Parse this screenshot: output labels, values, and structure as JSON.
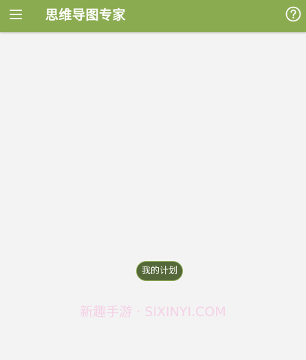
{
  "toolbar": {
    "title": "思维导图专家",
    "menu_icon": "hamburger-menu-icon",
    "help_icon": "help-circle-icon",
    "background_color": "#8bab51"
  },
  "canvas": {
    "background_color": "#f3f3f3",
    "central_node": {
      "label": "我的计划",
      "fill_color": "#55683a"
    }
  },
  "watermark": {
    "text": "新趣手游 · SIXINYI.COM"
  }
}
